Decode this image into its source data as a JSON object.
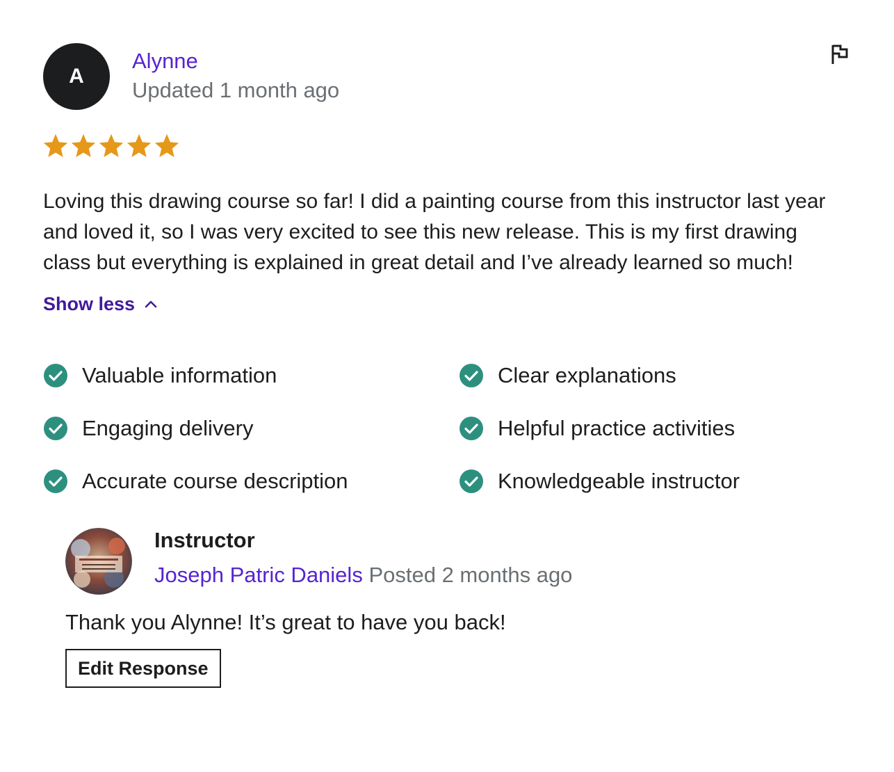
{
  "review": {
    "avatar_initial": "A",
    "reviewer_name": "Alynne",
    "updated_text": "Updated 1 month ago",
    "flag_icon": "flag-icon",
    "rating": 5,
    "rating_max": 5,
    "star_color": "#e59819",
    "body": "Loving this drawing course so far! I did a painting course from this instructor last year and loved it, so I was very excited to see this new release. This is my first drawing class but everything is explained in great detail and I’ve already learned so much!",
    "toggle_label": "Show less",
    "toggle_icon": "chevron-up-icon",
    "tags": [
      "Valuable information",
      "Clear explanations",
      "Engaging delivery",
      "Helpful practice activities",
      "Accurate course description",
      "Knowledgeable instructor"
    ],
    "check_color": "#2d907f"
  },
  "response": {
    "role": "Instructor",
    "author": "Joseph Patric Daniels",
    "posted_text": "Posted 2 months ago",
    "text": "Thank you Alynne! It’s great to have you back!",
    "edit_label": "Edit Response"
  },
  "colors": {
    "accent": "#5624d0",
    "link_dark": "#401b9c",
    "muted": "#6a6f73",
    "text": "#1c1d1f"
  }
}
